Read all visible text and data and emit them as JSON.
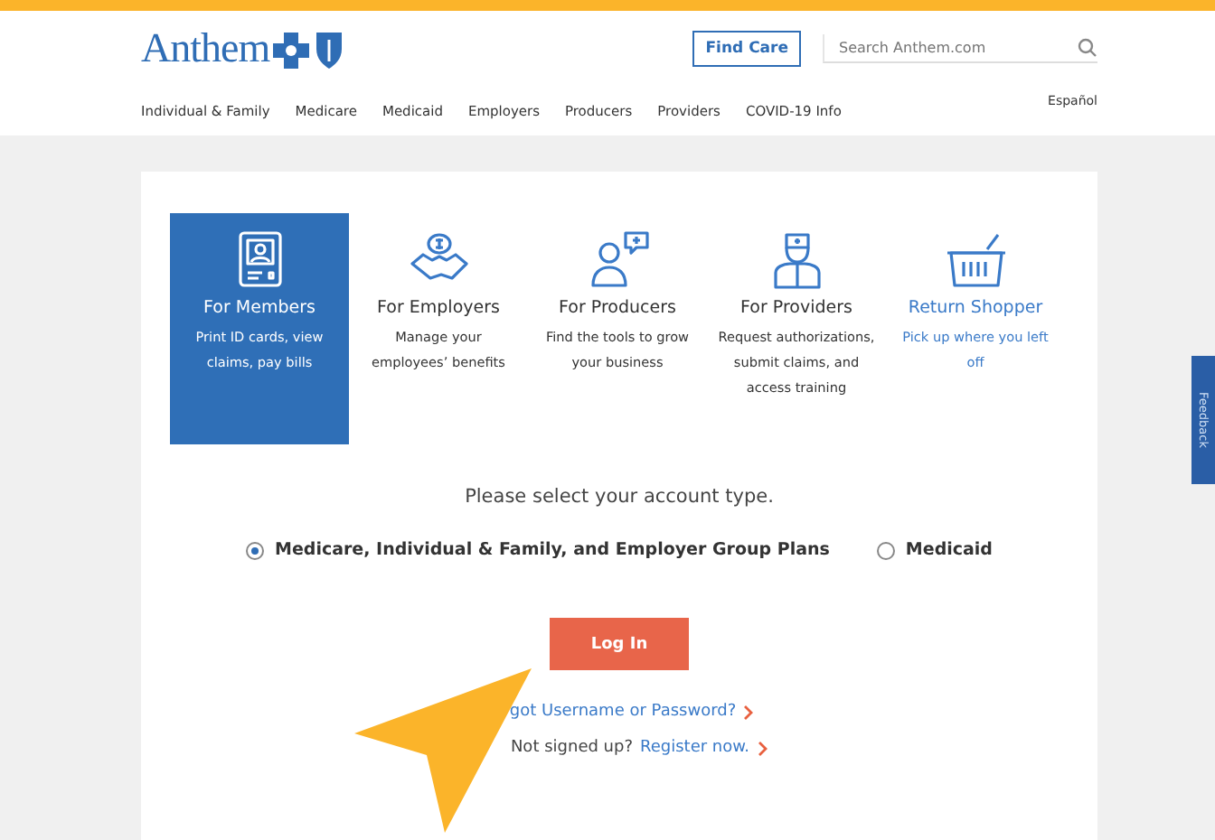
{
  "header": {
    "logo": "Anthem",
    "find_care": "Find Care",
    "search": {
      "placeholder": "Search Anthem.com"
    },
    "language": "Español",
    "nav": [
      "Individual & Family",
      "Medicare",
      "Medicaid",
      "Employers",
      "Producers",
      "Providers",
      "COVID-19 Info"
    ]
  },
  "account_tiles": [
    {
      "kind": "card",
      "title": "For Members",
      "description": "Print ID cards, view claims, pay bills",
      "selected": true
    },
    {
      "kind": "handshake",
      "title": "For Employers",
      "description": "Manage your employees’ benefits",
      "selected": false
    },
    {
      "kind": "chat",
      "title": "For Producers",
      "description": "Find the tools to grow your business",
      "selected": false
    },
    {
      "kind": "doctor",
      "title": "For Providers",
      "description": "Request authorizations, submit claims, and access training",
      "selected": false
    },
    {
      "kind": "basket",
      "title": "Return Shopper",
      "description": "Pick up where you left off",
      "selected": false
    }
  ],
  "prompt": "Please select your account type.",
  "account_types": [
    {
      "label": "Medicare, Individual & Family, and Employer Group Plans",
      "selected": true
    },
    {
      "label": "Medicaid",
      "selected": false
    }
  ],
  "login_button": "Log In",
  "forgot_link": "got Username or Password?",
  "signup_text": "Not signed up?",
  "register_link": "Register now.",
  "feedback_tab": "Feedback"
}
